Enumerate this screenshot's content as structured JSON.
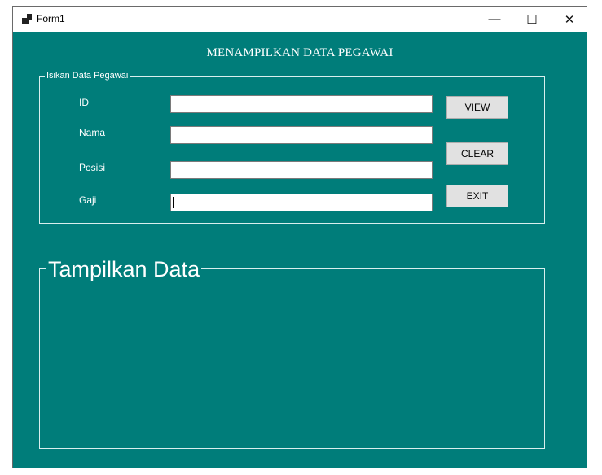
{
  "window": {
    "title": "Form1",
    "minimize_glyph": "—",
    "maximize_glyph": "☐",
    "close_glyph": "✕",
    "icon": "form-app-icon"
  },
  "form": {
    "heading": "MENAMPILKAN DATA PEGAWAI",
    "input_group": {
      "legend": "Isikan Data Pegawai",
      "fields": [
        {
          "label": "ID",
          "value": ""
        },
        {
          "label": "Nama",
          "value": ""
        },
        {
          "label": "Posisi",
          "value": ""
        },
        {
          "label": "Gaji",
          "value": ""
        }
      ]
    },
    "buttons": {
      "view": "VIEW",
      "clear": "CLEAR",
      "exit": "EXIT"
    },
    "display_group": {
      "legend": "Tampilkan Data"
    }
  },
  "colors": {
    "form_background": "#007d7a",
    "text": "#ffffff",
    "button_face": "#e1e1e1"
  }
}
